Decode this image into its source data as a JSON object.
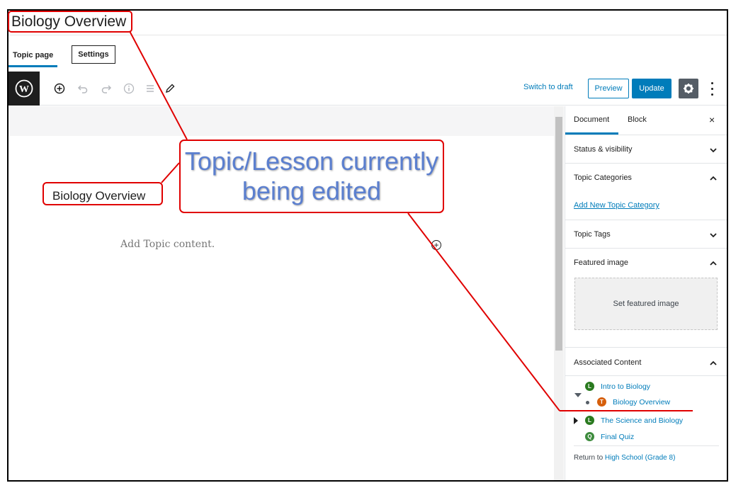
{
  "page": {
    "title": "Biology Overview"
  },
  "tabs": [
    {
      "label": "Topic page"
    },
    {
      "label": "Settings"
    }
  ],
  "toolbar": {
    "switch_to_draft": "Switch to draft",
    "preview_label": "Preview",
    "update_label": "Update",
    "icons": [
      "wordpress-icon",
      "add-block-icon",
      "undo-icon",
      "redo-icon",
      "info-icon",
      "list-view-icon",
      "pencil-icon",
      "gear-icon",
      "more-vertical-icon"
    ]
  },
  "editor": {
    "post_title": "Biology Overview",
    "placeholder": "Add Topic content."
  },
  "sidebar": {
    "tab_document": "Document",
    "tab_block": "Block",
    "close_symbol": "×",
    "status_visibility": "Status & visibility",
    "topic_categories": "Topic Categories",
    "add_new_category": "Add New Topic Category",
    "topic_tags": "Topic Tags",
    "featured_image": "Featured image",
    "set_featured_image": "Set featured image",
    "associated_content": "Associated Content",
    "items": [
      {
        "badge": "L",
        "label": "Intro to Biology"
      },
      {
        "badge": "T",
        "label": "Biology Overview"
      },
      {
        "badge": "L",
        "label": "The Science and Biology"
      },
      {
        "badge": "Q",
        "label": "Final Quiz"
      }
    ],
    "return_prefix": "Return to",
    "return_link": "High School (Grade 8)"
  },
  "annotation": {
    "callout_line1": "Topic/Lesson currently",
    "callout_line2": "being edited"
  },
  "colors": {
    "accent": "#007cba",
    "annotation_red": "#e00000",
    "annotation_text": "#5b7fcf",
    "lesson_badge": "#2a7a1f",
    "topic_badge": "#d65f0c"
  }
}
